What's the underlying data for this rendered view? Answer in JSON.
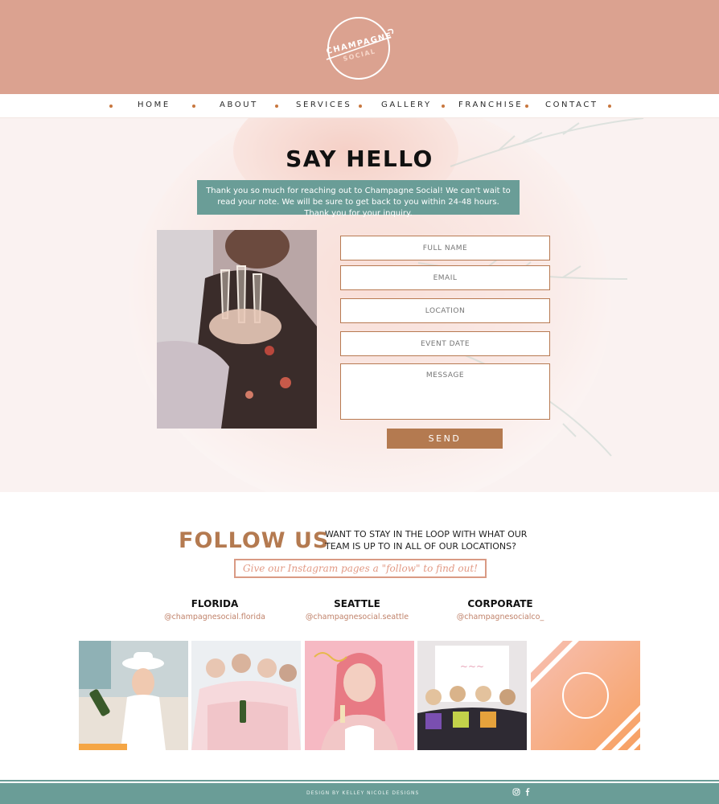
{
  "brand": {
    "logo_line1": "CHAMPAGNE",
    "logo_line2": "SOCIAL"
  },
  "nav": {
    "items": [
      "HOME",
      "ABOUT",
      "SERVICES",
      "GALLERY",
      "FRANCHISE",
      "CONTACT"
    ]
  },
  "contact": {
    "title": "SAY HELLO",
    "note": "Thank you so much for reaching out to Champagne Social!  We can't wait to read your note. We will be sure to get back to you within 24-48 hours.  Thank you for your inquiry.",
    "fields": {
      "full_name": "FULL NAME",
      "email": "EMAIL",
      "location": "LOCATION",
      "event_date": "EVENT DATE",
      "message": "MESSAGE"
    },
    "send_label": "SEND"
  },
  "follow": {
    "title": "FOLLOW US",
    "subtitle": "WANT TO STAY IN THE LOOP WITH WHAT OUR TEAM IS UP TO IN ALL OF OUR LOCATIONS?",
    "prompt": "Give our Instagram pages a \"follow\" to find out!",
    "locations": [
      {
        "name": "FLORIDA",
        "handle": "@champagnesocial.florida"
      },
      {
        "name": "SEATTLE",
        "handle": "@champagnesocial.seattle"
      },
      {
        "name": "CORPORATE",
        "handle": "@champagnesocialco_"
      }
    ]
  },
  "footer": {
    "credit": "DESIGN BY KELLEY NICOLE DESIGNS",
    "icons": [
      "instagram-icon",
      "facebook-icon"
    ]
  },
  "colors": {
    "header_bg": "#dba290",
    "accent_teal": "#6a9d97",
    "accent_copper": "#b47a50",
    "accent_pink": "#e29a85"
  }
}
